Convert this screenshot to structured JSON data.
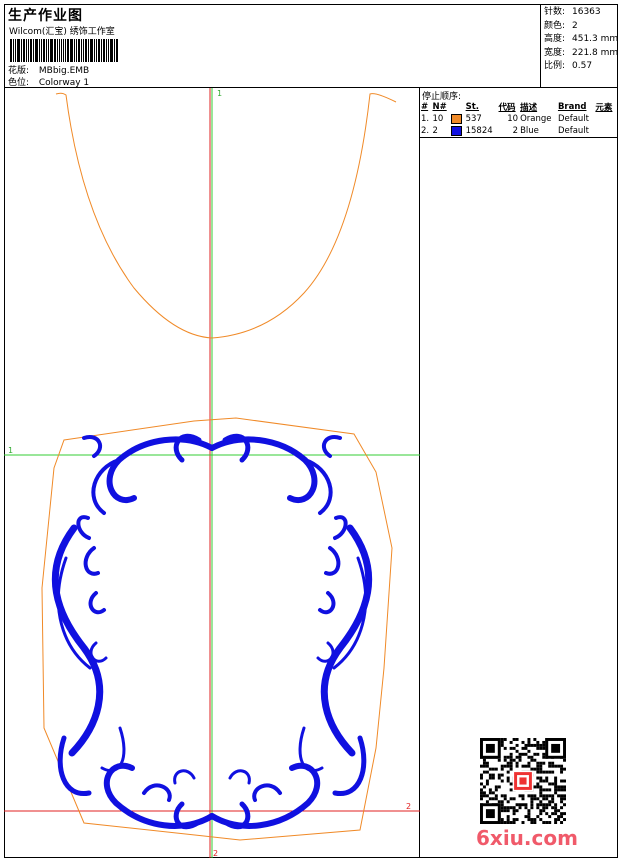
{
  "header": {
    "title": "生产作业图",
    "company": "Wilcom(汇宝) 绣饰工作室",
    "design_label": "花版:",
    "design_value": "MBbig.EMB",
    "colorway_label": "色位:",
    "colorway_value": "Colorway 1"
  },
  "stats": [
    {
      "label": "针数:",
      "value": "16363"
    },
    {
      "label": "颜色:",
      "value": "2"
    },
    {
      "label": "高度:",
      "value": "451.3 mm"
    },
    {
      "label": "宽度:",
      "value": "221.8 mm"
    },
    {
      "label": "比例:",
      "value": "0.57"
    }
  ],
  "stop_sequence": {
    "title": "停止顺序:",
    "columns": [
      "#",
      "N#",
      "St.",
      "代码",
      "描述",
      "Brand",
      "元素"
    ],
    "rows": [
      {
        "idx": "1.",
        "n": "10",
        "color": "#f08a28",
        "st": "537",
        "code": "10",
        "desc": "Orange",
        "brand": "Default"
      },
      {
        "idx": "2.",
        "n": "2",
        "color": "#1010e0",
        "st": "15824",
        "code": "2",
        "desc": "Blue",
        "brand": "Default"
      }
    ]
  },
  "axes": {
    "v_top": "1",
    "v_bottom": "2",
    "h_left": "1",
    "h_right": "2"
  },
  "colors": {
    "outline": "#f08a28",
    "embroidery": "#1010e0",
    "guide_green": "#33cc33",
    "guide_red": "#e02020"
  },
  "watermark": "6xiu.com",
  "icons": {
    "qr": "qr-code-icon"
  }
}
